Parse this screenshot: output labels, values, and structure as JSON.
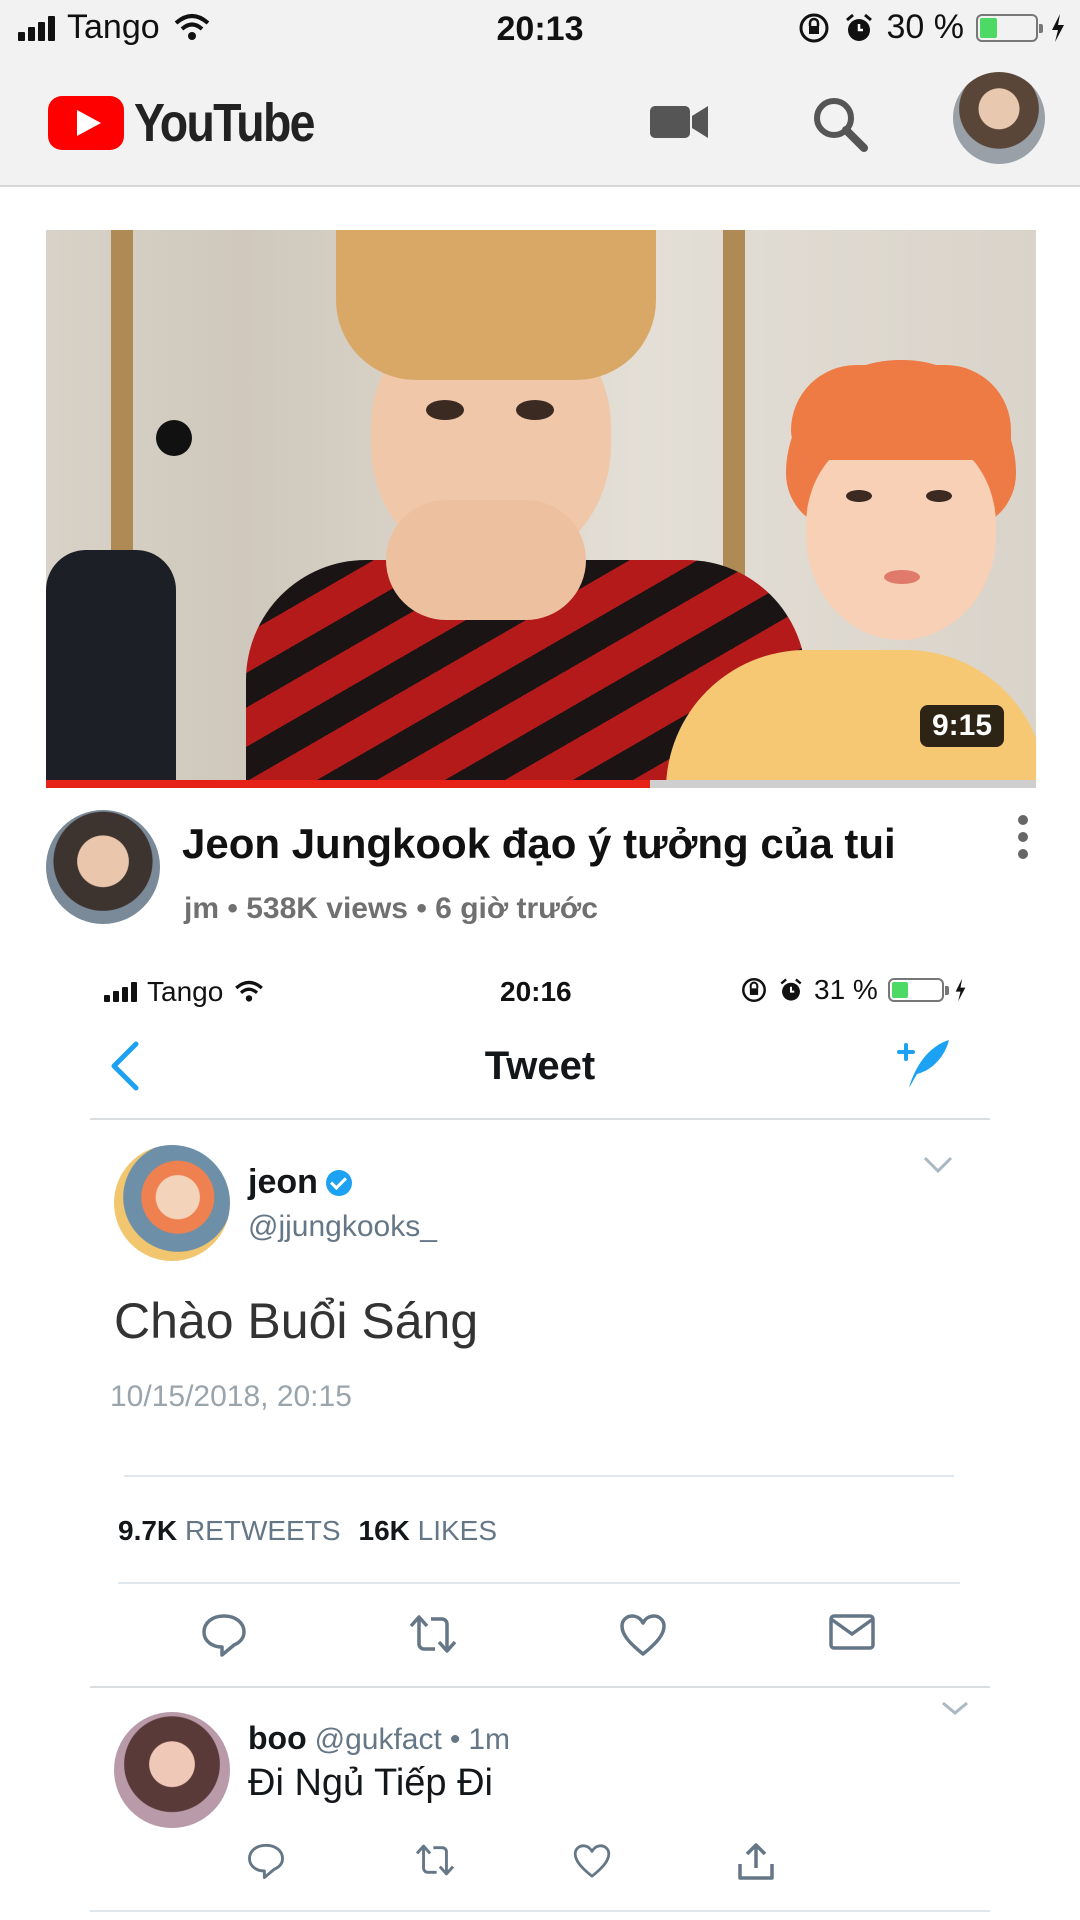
{
  "status_bar": {
    "carrier": "Tango",
    "time": "20:13",
    "battery_text": "30 %",
    "battery_level": 0.3
  },
  "youtube": {
    "logo_text": "YouTube",
    "icons": [
      "video-camera-icon",
      "search-icon",
      "account-avatar"
    ]
  },
  "video": {
    "duration": "9:15",
    "progress": 0.61,
    "title": "Jeon Jungkook đạo ý tưởng của tui",
    "channel": "jm",
    "views": "538K views",
    "age": "6 giờ trước"
  },
  "tweet_screen": {
    "status_bar": {
      "carrier": "Tango",
      "time": "20:16",
      "battery_text": "31 %",
      "battery_level": 0.31
    },
    "header_title": "Tweet",
    "tweet": {
      "name": "jeon",
      "handle": "@jjungkooks_",
      "text": "Chào Buổi Sáng",
      "timestamp": "10/15/2018, 20:15",
      "retweets": "9.7K",
      "retweets_label": "RETWEETS",
      "likes": "16K",
      "likes_label": "LIKES"
    },
    "reply": {
      "name": "boo",
      "handle": "@gukfact",
      "age": "1m",
      "text": "Đi Ngủ Tiếp Đi"
    }
  },
  "colors": {
    "youtube_red": "#ff0000",
    "progress_red": "#e62117",
    "twitter_blue": "#1da1f2",
    "battery_green": "#4cd964"
  }
}
